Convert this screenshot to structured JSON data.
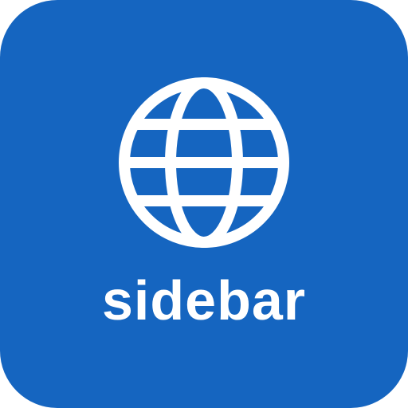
{
  "icon": {
    "label": "sidebar",
    "symbol": "globe-icon",
    "background_color": "#1565C0",
    "foreground_color": "#FFFFFF"
  }
}
